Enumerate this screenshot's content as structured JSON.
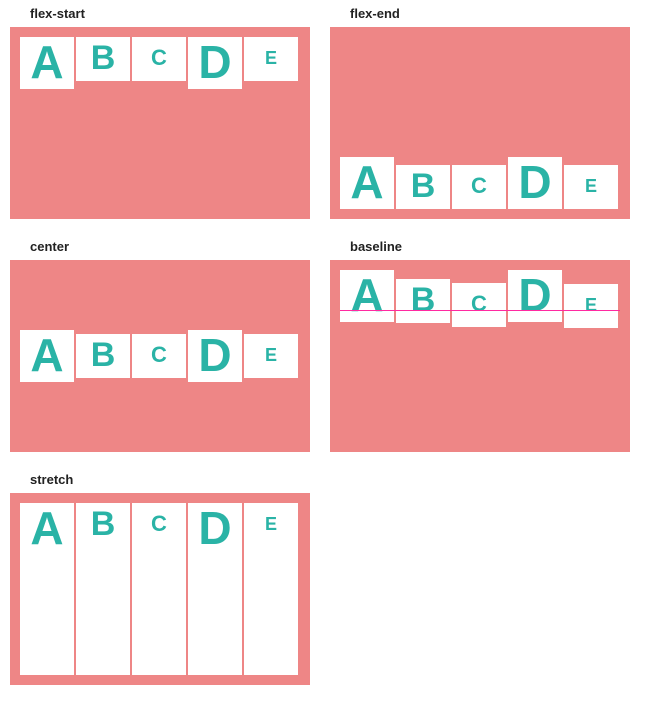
{
  "colors": {
    "container_bg": "#ee8686",
    "item_bg": "#ffffff",
    "item_fg": "#2ab3a6",
    "baseline_line": "#ff2aa1"
  },
  "items": [
    "A",
    "B",
    "C",
    "D",
    "E"
  ],
  "panels": [
    {
      "id": "flex-start",
      "label": "flex-start",
      "align": "flex-start",
      "has_baseline_line": false
    },
    {
      "id": "flex-end",
      "label": "flex-end",
      "align": "flex-end",
      "has_baseline_line": false
    },
    {
      "id": "center",
      "label": "center",
      "align": "center",
      "has_baseline_line": false
    },
    {
      "id": "baseline",
      "label": "baseline",
      "align": "baseline",
      "has_baseline_line": true
    },
    {
      "id": "stretch",
      "label": "stretch",
      "align": "stretch",
      "has_baseline_line": false
    }
  ]
}
